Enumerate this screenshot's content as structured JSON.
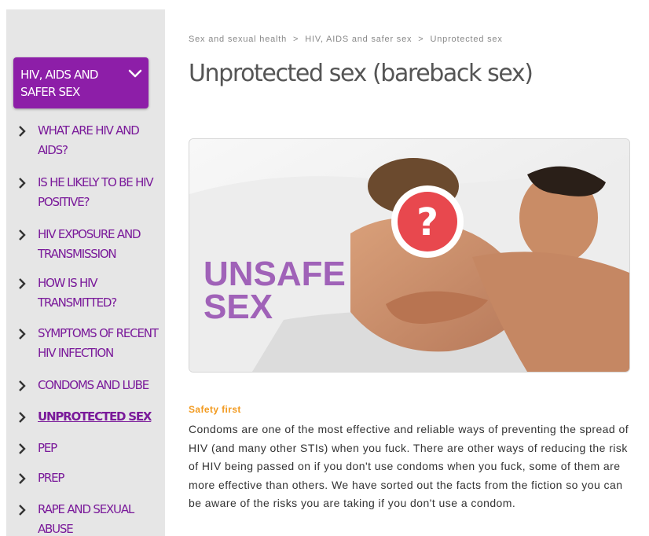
{
  "sidebar": {
    "section_title": "HIV, AIDS AND SAFER SEX",
    "items": [
      {
        "label": "WHAT ARE HIV AND AIDS?",
        "active": false
      },
      {
        "label": "IS HE LIKELY TO BE HIV POSITIVE?",
        "active": false
      },
      {
        "label": "HIV EXPOSURE AND TRANSMISSION",
        "active": false
      },
      {
        "label": "HOW IS HIV TRANSMITTED?",
        "active": false
      },
      {
        "label": "SYMPTOMS OF RECENT HIV INFECTION",
        "active": false
      },
      {
        "label": "CONDOMS AND LUBE",
        "active": false
      },
      {
        "label": "UNPROTECTED SEX",
        "active": true
      },
      {
        "label": "PEP",
        "active": false
      },
      {
        "label": "PREP",
        "active": false
      },
      {
        "label": "RAPE AND SEXUAL ABUSE",
        "active": false
      }
    ]
  },
  "breadcrumb": {
    "items": [
      "Sex and sexual health",
      "HIV, AIDS and safer sex",
      "Unprotected sex"
    ],
    "separator": ">"
  },
  "page": {
    "title": "Unprotected sex (bareback sex)"
  },
  "hero": {
    "overlay_line1": "UNSAFE",
    "overlay_line2": "SEX",
    "badge_glyph": "?"
  },
  "article": {
    "heading": "Safety first",
    "paragraph": "Condoms are one of the most effective and reliable ways of preventing the spread of HIV (and many other STIs) when you fuck. There are other ways of reducing the risk of HIV being passed on if you don't use condoms when you fuck, some of them are more effective than others. We have sorted out the facts from the fiction so you can be aware of the risks you are taking if you don't use a condom."
  },
  "colors": {
    "accent_purple": "#8d1ea8",
    "nav_purple": "#7a1a9a",
    "heading_orange": "#f29a1f",
    "overlay_purple": "#a062b8",
    "badge_red": "#e8484e"
  },
  "icons": {
    "section_toggle": "chevron-down-icon",
    "nav_item": "chevron-right-icon"
  }
}
